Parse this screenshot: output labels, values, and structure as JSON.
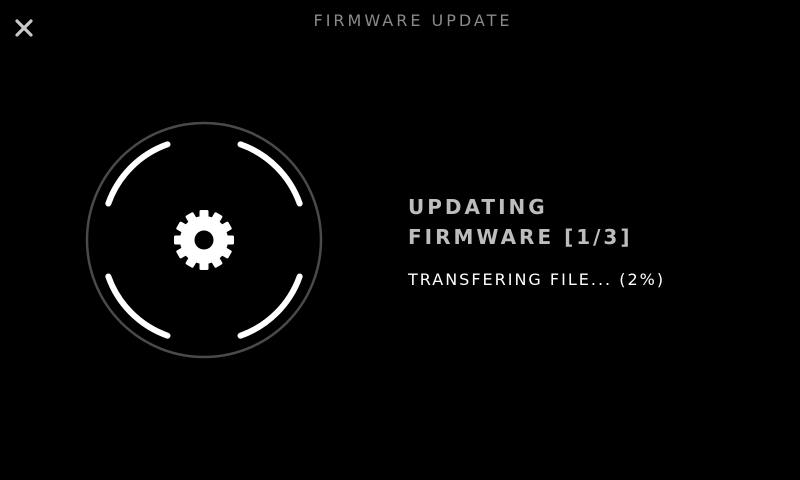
{
  "header": {
    "title": "FIRMWARE UPDATE",
    "close_icon": "close-icon"
  },
  "spinner": {
    "icon": "gear-icon",
    "ring_color": "#4a4a4a",
    "arc_color": "#ffffff"
  },
  "status": {
    "title_line1": "UPDATING",
    "title_line2": "FIRMWARE [1/3]",
    "detail": "TRANSFERING FILE... (2%)",
    "progress_percent": 2,
    "step_current": 1,
    "step_total": 3
  },
  "colors": {
    "background": "#000000",
    "title_text": "#bdbdbd",
    "header_text": "#8a8a8a",
    "detail_text": "#ffffff"
  }
}
